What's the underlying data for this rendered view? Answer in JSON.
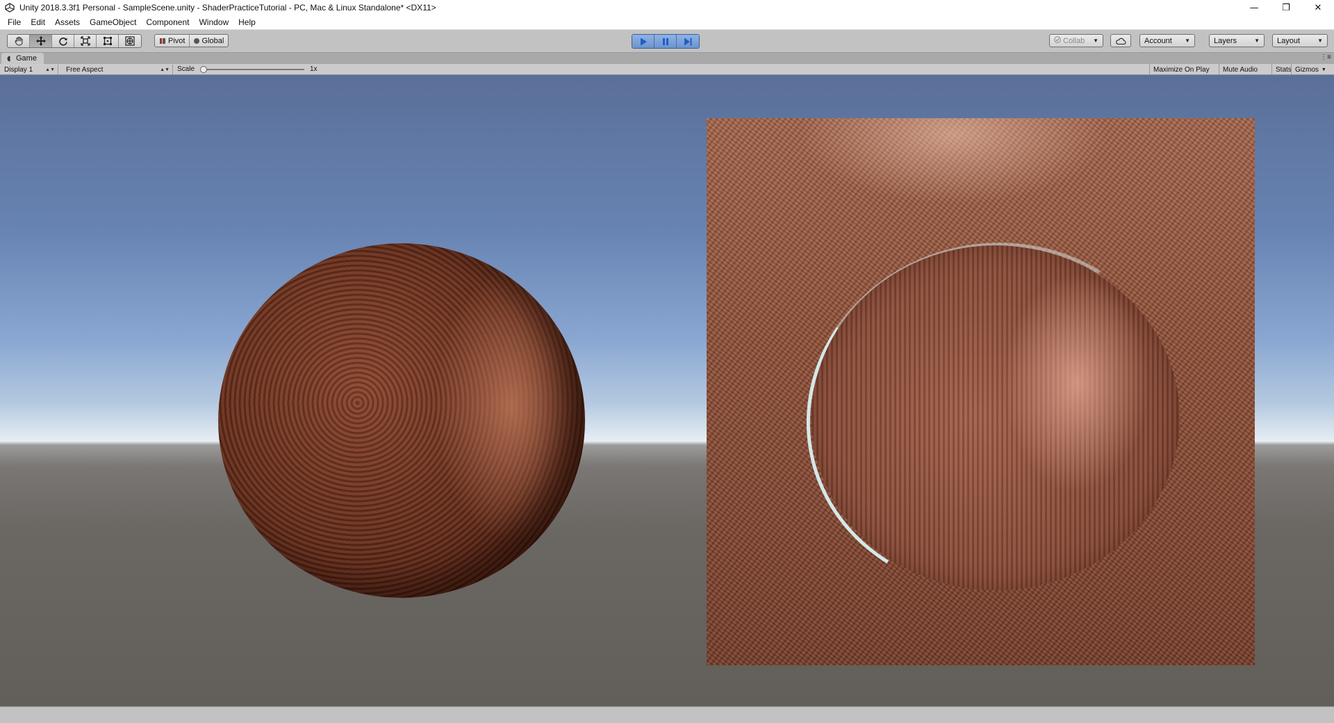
{
  "window": {
    "title": "Unity 2018.3.3f1 Personal - SampleScene.unity - ShaderPracticeTutorial - PC, Mac & Linux Standalone* <DX11>",
    "controls": {
      "minimize": "—",
      "restore": "❐",
      "close": "✕"
    }
  },
  "menu": {
    "items": [
      "File",
      "Edit",
      "Assets",
      "GameObject",
      "Component",
      "Window",
      "Help"
    ]
  },
  "toolbar": {
    "transform_tools": [
      "hand-icon",
      "move-icon",
      "rotate-icon",
      "scale-icon",
      "rect-icon",
      "transform-icon"
    ],
    "active_tool": "move-icon",
    "pivot_label": "Pivot",
    "global_label": "Global",
    "play_state": "playing",
    "collab_label": "Collab",
    "account_label": "Account",
    "layers_label": "Layers",
    "layout_label": "Layout",
    "accent_color": "#6c93cf"
  },
  "game_view": {
    "tab_label": "Game",
    "display_label": "Display 1",
    "aspect_label": "Free Aspect",
    "scale_label": "Scale",
    "scale_value": "1x",
    "maximize_label": "Maximize On Play",
    "mute_label": "Mute Audio",
    "stats_label": "Stats",
    "gizmos_label": "Gizmos"
  }
}
